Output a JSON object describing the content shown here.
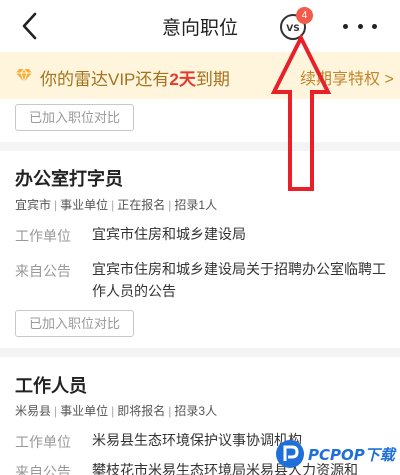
{
  "nav": {
    "title": "意向职位",
    "back_icon": "chevron-left-icon",
    "vs_label": "VS",
    "vs_badge": "4",
    "more_icon": "more-dots-icon"
  },
  "vip": {
    "text_pre": "你的雷达VIP还有",
    "days": "2天",
    "text_post": "到期",
    "link": "续期享特权",
    "link_arrow": ">",
    "icon": "diamond-icon",
    "color": "#a3731f",
    "accent": "#e53b2c"
  },
  "compare_label_top": "已加入职位对比",
  "jobs": [
    {
      "title": "办公室打字员",
      "location": "宜宾市",
      "type": "事业单位",
      "status": "正在报名",
      "quota": "招录1人",
      "employer_label": "工作单位",
      "employer": "宜宾市住房和城乡建设局",
      "source_label": "来自公告",
      "source": "宜宾市住房和城乡建设局关于招聘办公室临聘工作人员的公告",
      "compare_label": "已加入职位对比"
    },
    {
      "title": "工作人员",
      "location": "米易县",
      "type": "事业单位",
      "status": "即将报名",
      "quota": "招录3人",
      "employer_label": "工作单位",
      "employer": "米易县生态环境保护议事协调机构",
      "source_label": "来自公告",
      "source": "攀枝花市米易生态环境局米易县人力资源和"
    }
  ],
  "watermark": {
    "text": "PCPOP下载",
    "icon": "pcpop-logo-icon"
  },
  "annotation": {
    "color": "#e8202a"
  }
}
